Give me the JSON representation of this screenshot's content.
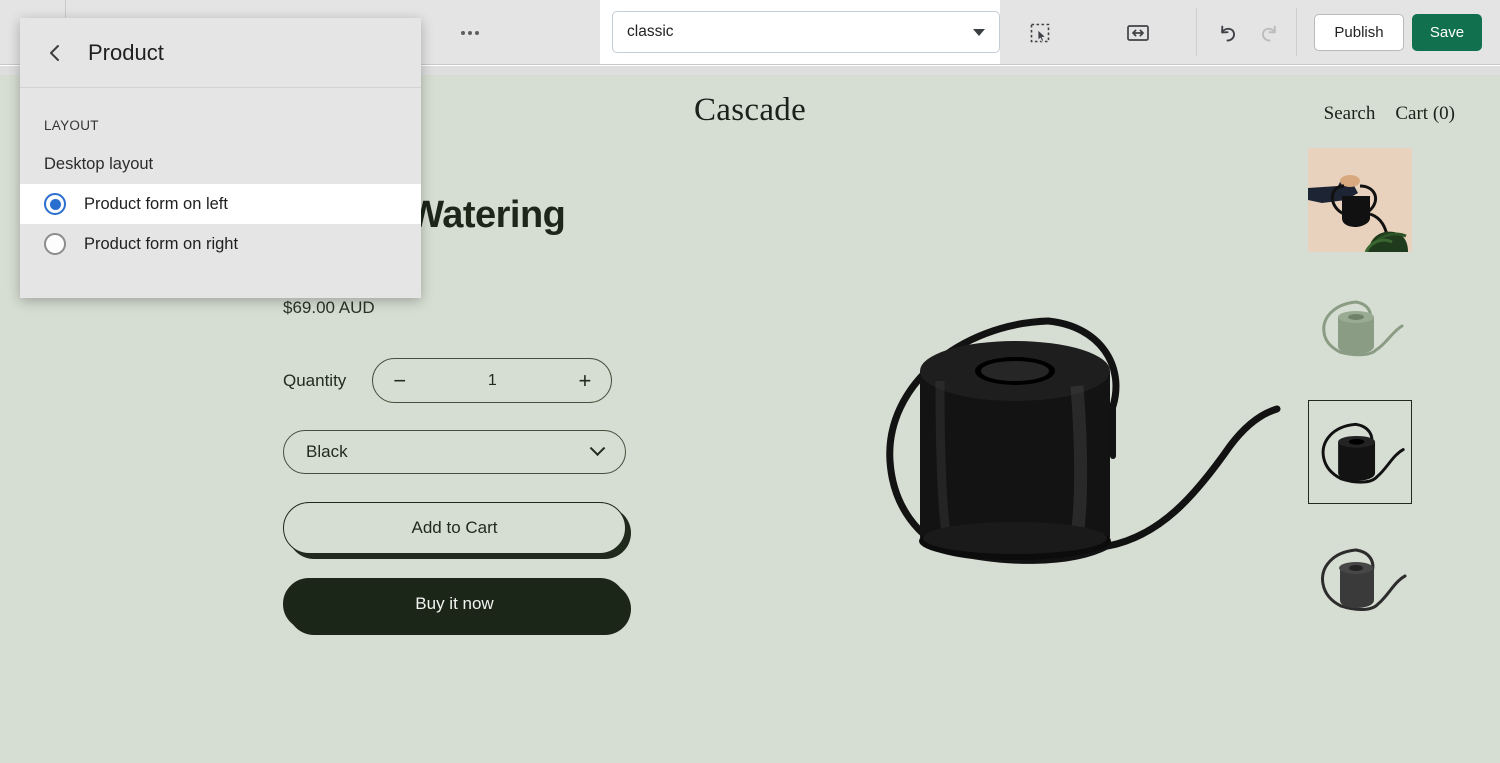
{
  "toolbar": {
    "more_icon": "ellipsis-icon",
    "page_select": {
      "value": "classic",
      "caret_icon": "caret-down-icon"
    },
    "select_tool_icon": "select-region-icon",
    "fit_tool_icon": "fit-width-icon",
    "undo_icon": "undo-arrow-icon",
    "redo_icon": "redo-arrow-icon",
    "publish_label": "Publish",
    "save_label": "Save",
    "save_color": "#11714f"
  },
  "panel": {
    "back_icon": "chevron-left-icon",
    "title": "Product",
    "section_label": "LAYOUT",
    "field_label": "Desktop layout",
    "options": [
      {
        "label": "Product form on left",
        "selected": true
      },
      {
        "label": "Product form on right",
        "selected": false
      }
    ],
    "accent_color": "#2a6fd0",
    "background_color": "#e5e5e5"
  },
  "storefront": {
    "background_color": "#d6ddd2",
    "logo": "Cascade",
    "nav": [
      {
        "label": "Search"
      },
      {
        "label": "Cart (0)"
      }
    ],
    "product": {
      "title": "Indoor Watering Can",
      "price": "$69.00 AUD",
      "quantity_label": "Quantity",
      "quantity_value": "1",
      "decrement_icon": "minus-icon",
      "increment_icon": "plus-icon",
      "variant_value": "Black",
      "variant_caret_icon": "chevron-down-icon",
      "add_to_cart_label": "Add to Cart",
      "buy_now_label": "Buy it now"
    },
    "thumbnails": [
      {
        "name": "lifestyle-photo-thumbnail",
        "selected": false
      },
      {
        "name": "sage-watering-can-thumbnail",
        "selected": false
      },
      {
        "name": "black-watering-can-thumbnail",
        "selected": true
      },
      {
        "name": "charcoal-watering-can-thumbnail",
        "selected": false
      }
    ]
  }
}
